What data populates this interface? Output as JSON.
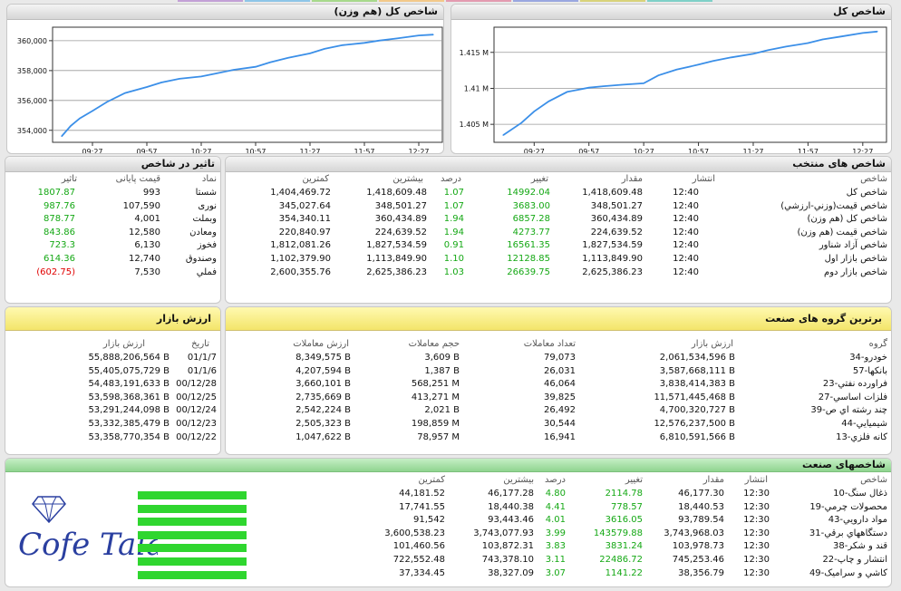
{
  "top_strip_colors": [
    "#c3a0d6",
    "#8ec6e8",
    "#a7d98c",
    "#f3c98a",
    "#e39bb0",
    "#9aa7e0",
    "#d8d27a",
    "#7fd0c8"
  ],
  "chart_left": {
    "title": "شاخص کل (هم وزن)",
    "chart_data": {
      "type": "line",
      "x": [
        "09:10",
        "09:15",
        "09:20",
        "09:27",
        "09:35",
        "09:45",
        "09:57",
        "10:05",
        "10:15",
        "10:27",
        "10:35",
        "10:45",
        "10:57",
        "11:05",
        "11:15",
        "11:27",
        "11:35",
        "11:45",
        "11:57",
        "12:05",
        "12:15",
        "12:27",
        "12:35"
      ],
      "values": [
        353600,
        354300,
        354800,
        355300,
        355900,
        356500,
        356900,
        357200,
        357450,
        357600,
        357800,
        358050,
        358250,
        358550,
        358850,
        359150,
        359450,
        359700,
        359850,
        360000,
        360150,
        360350,
        360400
      ],
      "xticks": [
        "09:27",
        "09:57",
        "10:27",
        "10:57",
        "11:27",
        "11:57",
        "12:27"
      ],
      "yticks": [
        "354,000",
        "356,000",
        "358,000",
        "360,000"
      ],
      "ylim": [
        353200,
        360900
      ]
    }
  },
  "chart_right": {
    "title": "شاخص کل",
    "chart_data": {
      "type": "line",
      "x": [
        "09:10",
        "09:20",
        "09:27",
        "09:35",
        "09:45",
        "09:57",
        "10:05",
        "10:15",
        "10:27",
        "10:35",
        "10:45",
        "10:57",
        "11:05",
        "11:15",
        "11:27",
        "11:35",
        "11:45",
        "11:57",
        "12:05",
        "12:15",
        "12:27",
        "12:35"
      ],
      "values": [
        1.4035,
        1.4052,
        1.4068,
        1.4082,
        1.4095,
        1.4101,
        1.4103,
        1.4105,
        1.4107,
        1.4118,
        1.4126,
        1.4133,
        1.4138,
        1.4143,
        1.4148,
        1.4153,
        1.4158,
        1.4163,
        1.4168,
        1.4172,
        1.4177,
        1.4179
      ],
      "xticks": [
        "09:27",
        "09:57",
        "10:27",
        "10:57",
        "11:27",
        "11:57",
        "12:27"
      ],
      "yticks": [
        "1.405 M",
        "1.41 M",
        "1.415 M"
      ],
      "ylim": [
        1.4025,
        1.4185
      ]
    }
  },
  "impact": {
    "title": "تاثیر در شاخص",
    "headers": {
      "symbol": "نماد",
      "final": "قیمت پایانی",
      "impact": "تاثیر"
    },
    "rows": [
      {
        "symbol": "شستا",
        "final": "993",
        "impact": "1807.87",
        "neg": false
      },
      {
        "symbol": "نوری",
        "final": "107,590",
        "impact": "987.76",
        "neg": false
      },
      {
        "symbol": "وبملت",
        "final": "4,001",
        "impact": "878.77",
        "neg": false
      },
      {
        "symbol": "ومعادن",
        "final": "12,580",
        "impact": "843.86",
        "neg": false
      },
      {
        "symbol": "فخوز",
        "final": "6,130",
        "impact": "723.3",
        "neg": false
      },
      {
        "symbol": "وصندوق",
        "final": "12,740",
        "impact": "614.36",
        "neg": false
      },
      {
        "symbol": "فملي",
        "final": "7,530",
        "impact": "(602.75)",
        "neg": true
      }
    ]
  },
  "indices": {
    "title": "شاخص های منتخب",
    "headers": {
      "name": "شاخص",
      "time": "انتشار",
      "value": "مقدار",
      "change": "تغییر",
      "pct": "درصد",
      "max": "بیشترین",
      "min": "کمترین"
    },
    "rows": [
      {
        "name": "شاخص کل",
        "time": "12:40",
        "value": "1,418,609.48",
        "change": "14992.04",
        "pct": "1.07",
        "max": "1,418,609.48",
        "min": "1,404,469.72"
      },
      {
        "name": "شاخص قیمت(وزني-ارزشي)",
        "time": "12:40",
        "value": "348,501.27",
        "change": "3683.00",
        "pct": "1.07",
        "max": "348,501.27",
        "min": "345,027.64"
      },
      {
        "name": "شاخص کل (هم وزن)",
        "time": "12:40",
        "value": "360,434.89",
        "change": "6857.28",
        "pct": "1.94",
        "max": "360,434.89",
        "min": "354,340.11"
      },
      {
        "name": "شاخص قیمت (هم وزن)",
        "time": "12:40",
        "value": "224,639.52",
        "change": "4273.77",
        "pct": "1.94",
        "max": "224,639.52",
        "min": "220,840.97"
      },
      {
        "name": "شاخص آزاد شناور",
        "time": "12:40",
        "value": "1,827,534.59",
        "change": "16561.35",
        "pct": "0.91",
        "max": "1,827,534.59",
        "min": "1,812,081.26"
      },
      {
        "name": "شاخص بازار اول",
        "time": "12:40",
        "value": "1,113,849.90",
        "change": "12128.85",
        "pct": "1.10",
        "max": "1,113,849.90",
        "min": "1,102,379.90"
      },
      {
        "name": "شاخص بازار دوم",
        "time": "12:40",
        "value": "2,625,386.23",
        "change": "26639.75",
        "pct": "1.03",
        "max": "2,625,386.23",
        "min": "2,600,355.76"
      }
    ]
  },
  "market_value": {
    "title": "ارزش بازار",
    "headers": {
      "date": "تاریخ",
      "value": "ارزش بازار"
    },
    "rows": [
      {
        "date": "01/1/7",
        "value": "55,888,206,564 B"
      },
      {
        "date": "01/1/6",
        "value": "55,405,075,729 B"
      },
      {
        "date": "00/12/28",
        "value": "54,483,191,633 B"
      },
      {
        "date": "00/12/25",
        "value": "53,598,368,361 B"
      },
      {
        "date": "00/12/24",
        "value": "53,291,244,098 B"
      },
      {
        "date": "00/12/23",
        "value": "53,332,385,479 B"
      },
      {
        "date": "00/12/22",
        "value": "53,358,770,354 B"
      }
    ]
  },
  "top_groups": {
    "title": "برترین گروه های صنعت",
    "headers": {
      "group": "گروه",
      "mcap": "ارزش بازار",
      "count": "تعداد معاملات",
      "volume": "حجم معاملات",
      "value": "ارزش معاملات"
    },
    "rows": [
      {
        "group": "34-خودرو",
        "mcap": "2,061,534,596 B",
        "count": "79,073",
        "volume": "3,609 B",
        "value": "8,349,575 B"
      },
      {
        "group": "57-بانکها",
        "mcap": "3,587,668,111 B",
        "count": "26,031",
        "volume": "1,387 B",
        "value": "4,207,594 B"
      },
      {
        "group": "23-فراورده نفتي",
        "mcap": "3,838,414,383 B",
        "count": "46,064",
        "volume": "568,251 M",
        "value": "3,660,101 B"
      },
      {
        "group": "27-فلزات اساسي",
        "mcap": "11,571,445,468 B",
        "count": "39,825",
        "volume": "413,271 M",
        "value": "2,735,669 B"
      },
      {
        "group": "39-چند رشته اي ص",
        "mcap": "4,700,320,727 B",
        "count": "26,492",
        "volume": "2,021 B",
        "value": "2,542,224 B"
      },
      {
        "group": "44-شيميايي",
        "mcap": "12,576,237,500 B",
        "count": "30,544",
        "volume": "198,859 M",
        "value": "2,505,323 B"
      },
      {
        "group": "13-کانه فلزي",
        "mcap": "6,810,591,566 B",
        "count": "16,941",
        "volume": "78,957 M",
        "value": "1,047,622 B"
      }
    ]
  },
  "industry": {
    "title": "شاخصهای صنعت",
    "headers": {
      "name": "شاخص",
      "time": "انتشار",
      "value": "مقدار",
      "change": "تغییر",
      "pct": "درصد",
      "max": "بیشترین",
      "min": "کمترین"
    },
    "rows": [
      {
        "name": "10-ذغال سنگ",
        "time": "12:30",
        "value": "46,177.30",
        "change": "2114.78",
        "pct": "4.80",
        "max": "46,177.28",
        "min": "44,181.52"
      },
      {
        "name": "19-محصولات چرمي",
        "time": "12:30",
        "value": "18,440.53",
        "change": "778.57",
        "pct": "4.41",
        "max": "18,440.38",
        "min": "17,741.55"
      },
      {
        "name": "43-مواد دارويي",
        "time": "12:30",
        "value": "93,789.54",
        "change": "3616.05",
        "pct": "4.01",
        "max": "93,443.46",
        "min": "91,542"
      },
      {
        "name": "31-دستگاههاي برقي",
        "time": "12:30",
        "value": "3,743,968.03",
        "change": "143579.88",
        "pct": "3.99",
        "max": "3,743,077.93",
        "min": "3,600,538.23"
      },
      {
        "name": "38-قند و شکر",
        "time": "12:30",
        "value": "103,978.73",
        "change": "3831.24",
        "pct": "3.83",
        "max": "103,872.31",
        "min": "101,460.56"
      },
      {
        "name": "22-انتشار و چاپ",
        "time": "12:30",
        "value": "745,253.46",
        "change": "22486.72",
        "pct": "3.11",
        "max": "743,378.10",
        "min": "722,552.48"
      },
      {
        "name": "49-کاشي و سراميک",
        "time": "12:30",
        "value": "38,356.79",
        "change": "1141.22",
        "pct": "3.07",
        "max": "38,327.09",
        "min": "37,334.45"
      }
    ]
  },
  "watermark": {
    "text": "Cofe Tala"
  }
}
